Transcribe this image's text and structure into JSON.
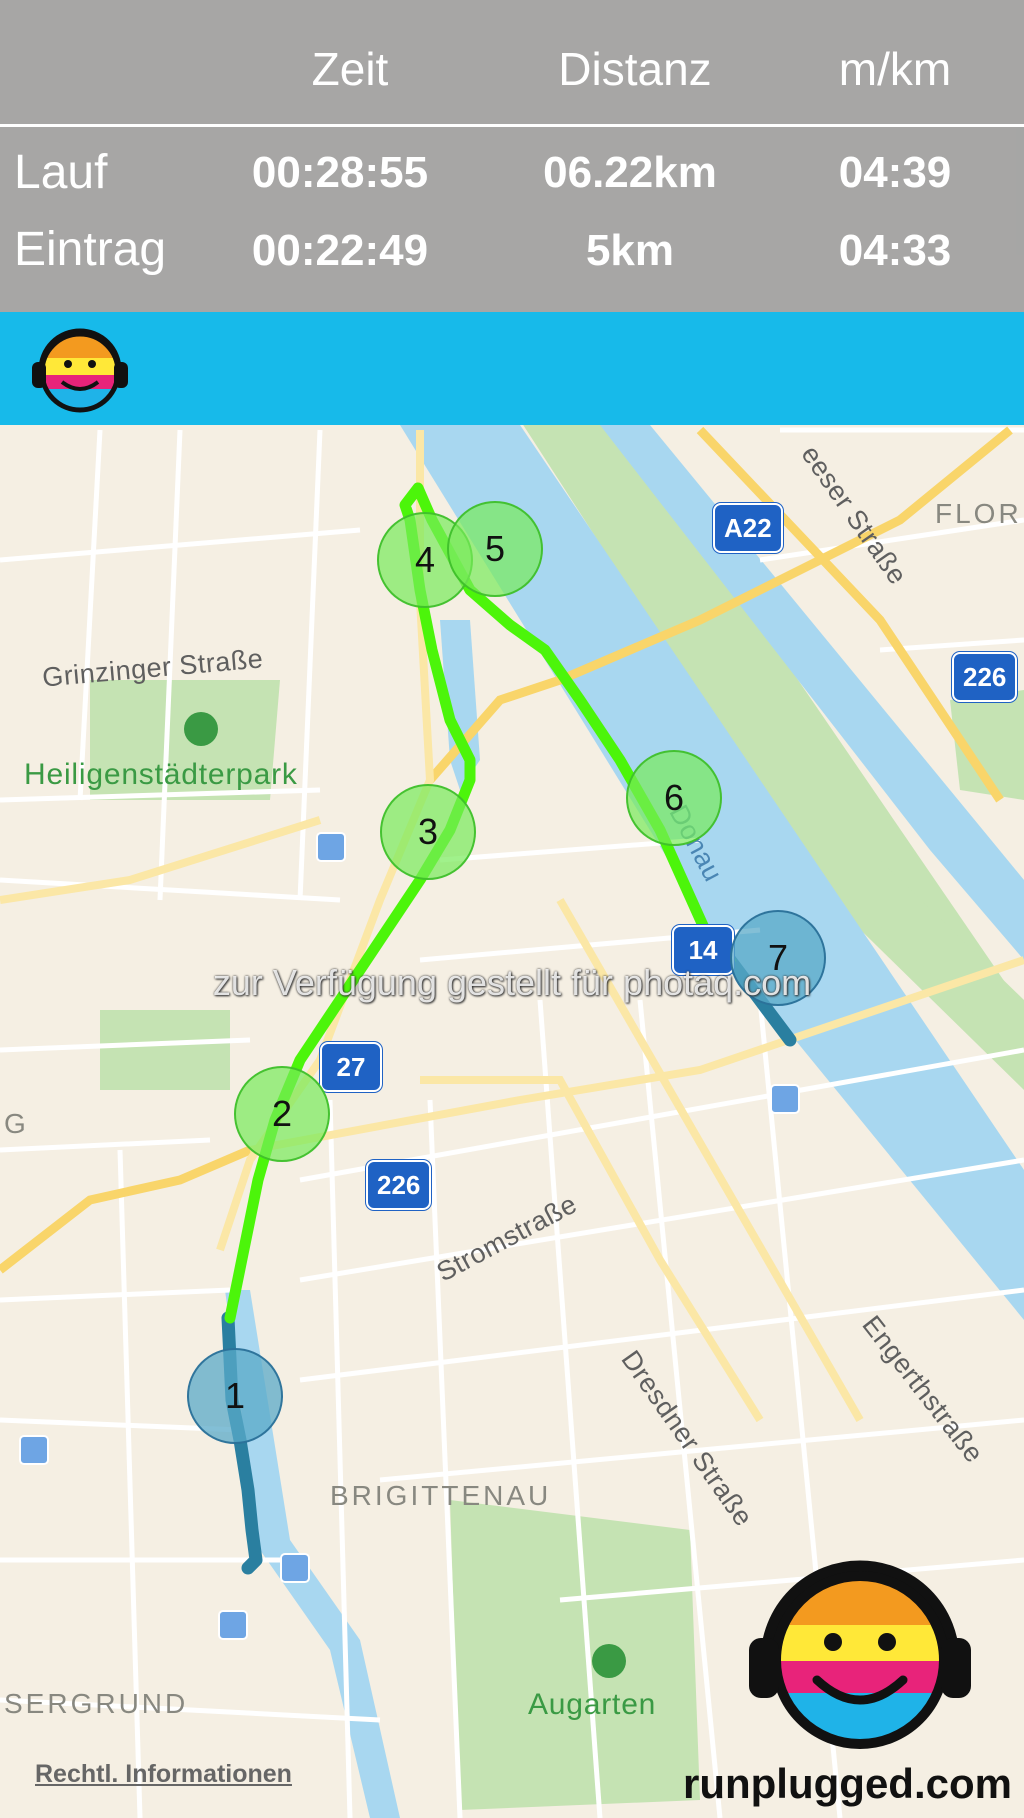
{
  "stats": {
    "headers": {
      "time": "Zeit",
      "distance": "Distanz",
      "pace": "m/km"
    },
    "run": {
      "label": "Lauf",
      "time": "00:28:55",
      "distance": "06.22km",
      "pace": "04:39"
    },
    "entry": {
      "label": "Eintrag",
      "time": "00:22:49",
      "distance": "5km",
      "pace": "04:33"
    }
  },
  "map": {
    "streets": {
      "grinzinger": "Grinzinger Straße",
      "stromstrasse": "Stromstraße",
      "dresdner": "Dresdner Straße",
      "engerthstrasse": "Engerthstraße",
      "leeser": "eeser Straße"
    },
    "parks": {
      "heiligenstadt": "Heiligenstädterpark",
      "augarten": "Augarten"
    },
    "districts": {
      "brigittenau": "BRIGITTENAU",
      "sergrund": "SERGRUND",
      "flor": "FLOR",
      "g": "G"
    },
    "river": "Donau",
    "road_shields": {
      "a22": "A22",
      "r226_top": "226",
      "r226_mid": "226",
      "r14": "14",
      "r27": "27"
    },
    "markers": [
      "1",
      "2",
      "3",
      "4",
      "5",
      "6",
      "7"
    ],
    "legal_link": "Rechtl. Informationen"
  },
  "watermark": "zur Verfügung gestellt für photaq.com",
  "brand": "runplugged.com",
  "colors": {
    "accent_bar": "#17baea",
    "route_green": "#4cf50a",
    "route_teal": "#2a7fa0"
  }
}
